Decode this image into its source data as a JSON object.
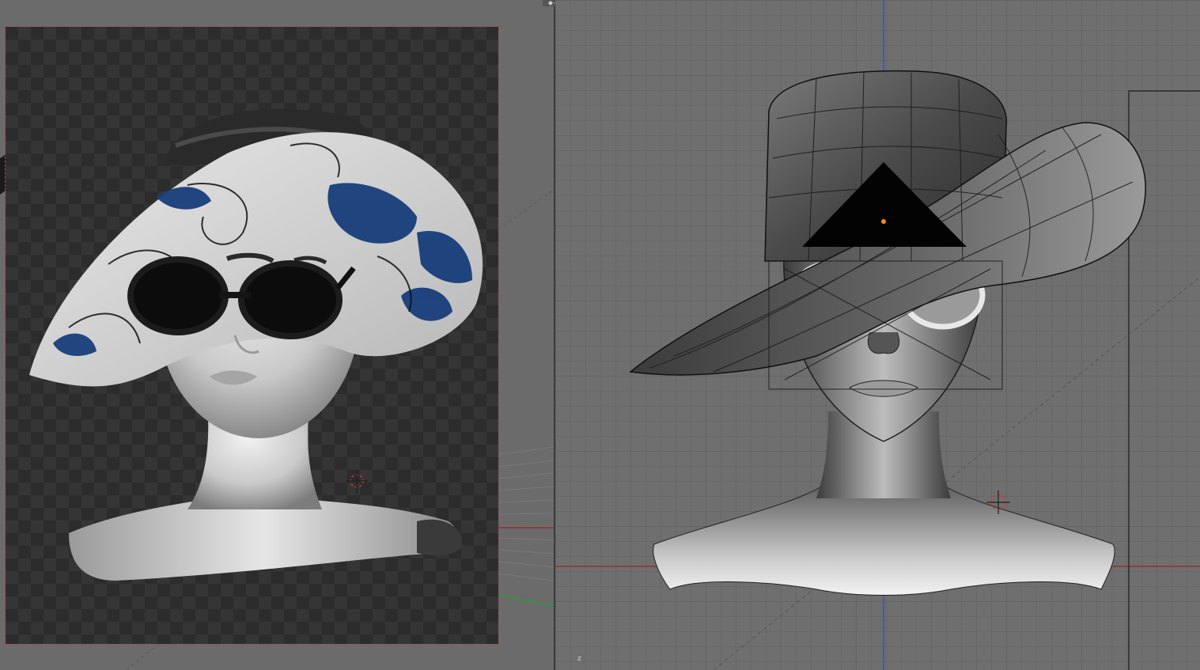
{
  "app": {
    "panels": [
      {
        "id": "render-preview",
        "kind": "rendered preview"
      },
      {
        "id": "front-viewport",
        "kind": "solid shading with wireframe"
      }
    ]
  },
  "header": {
    "split_handle": "◆◆"
  },
  "axis": {
    "z_label": "z"
  },
  "colors": {
    "viewport_bg": "#6f6f6f",
    "render_checker_dark": "#2c2c2c",
    "render_checker_light": "#353535",
    "render_border": "#b04848",
    "x_axis": "#a02a2a",
    "z_axis": "#3a52b8",
    "y_axis": "#2b9a3a",
    "hat_pattern_blue": "#173d7a",
    "lamp_dot": "#ff8a1a"
  },
  "icons": [
    "3d-cursor-icon",
    "lamp-icon",
    "camera-icon"
  ]
}
